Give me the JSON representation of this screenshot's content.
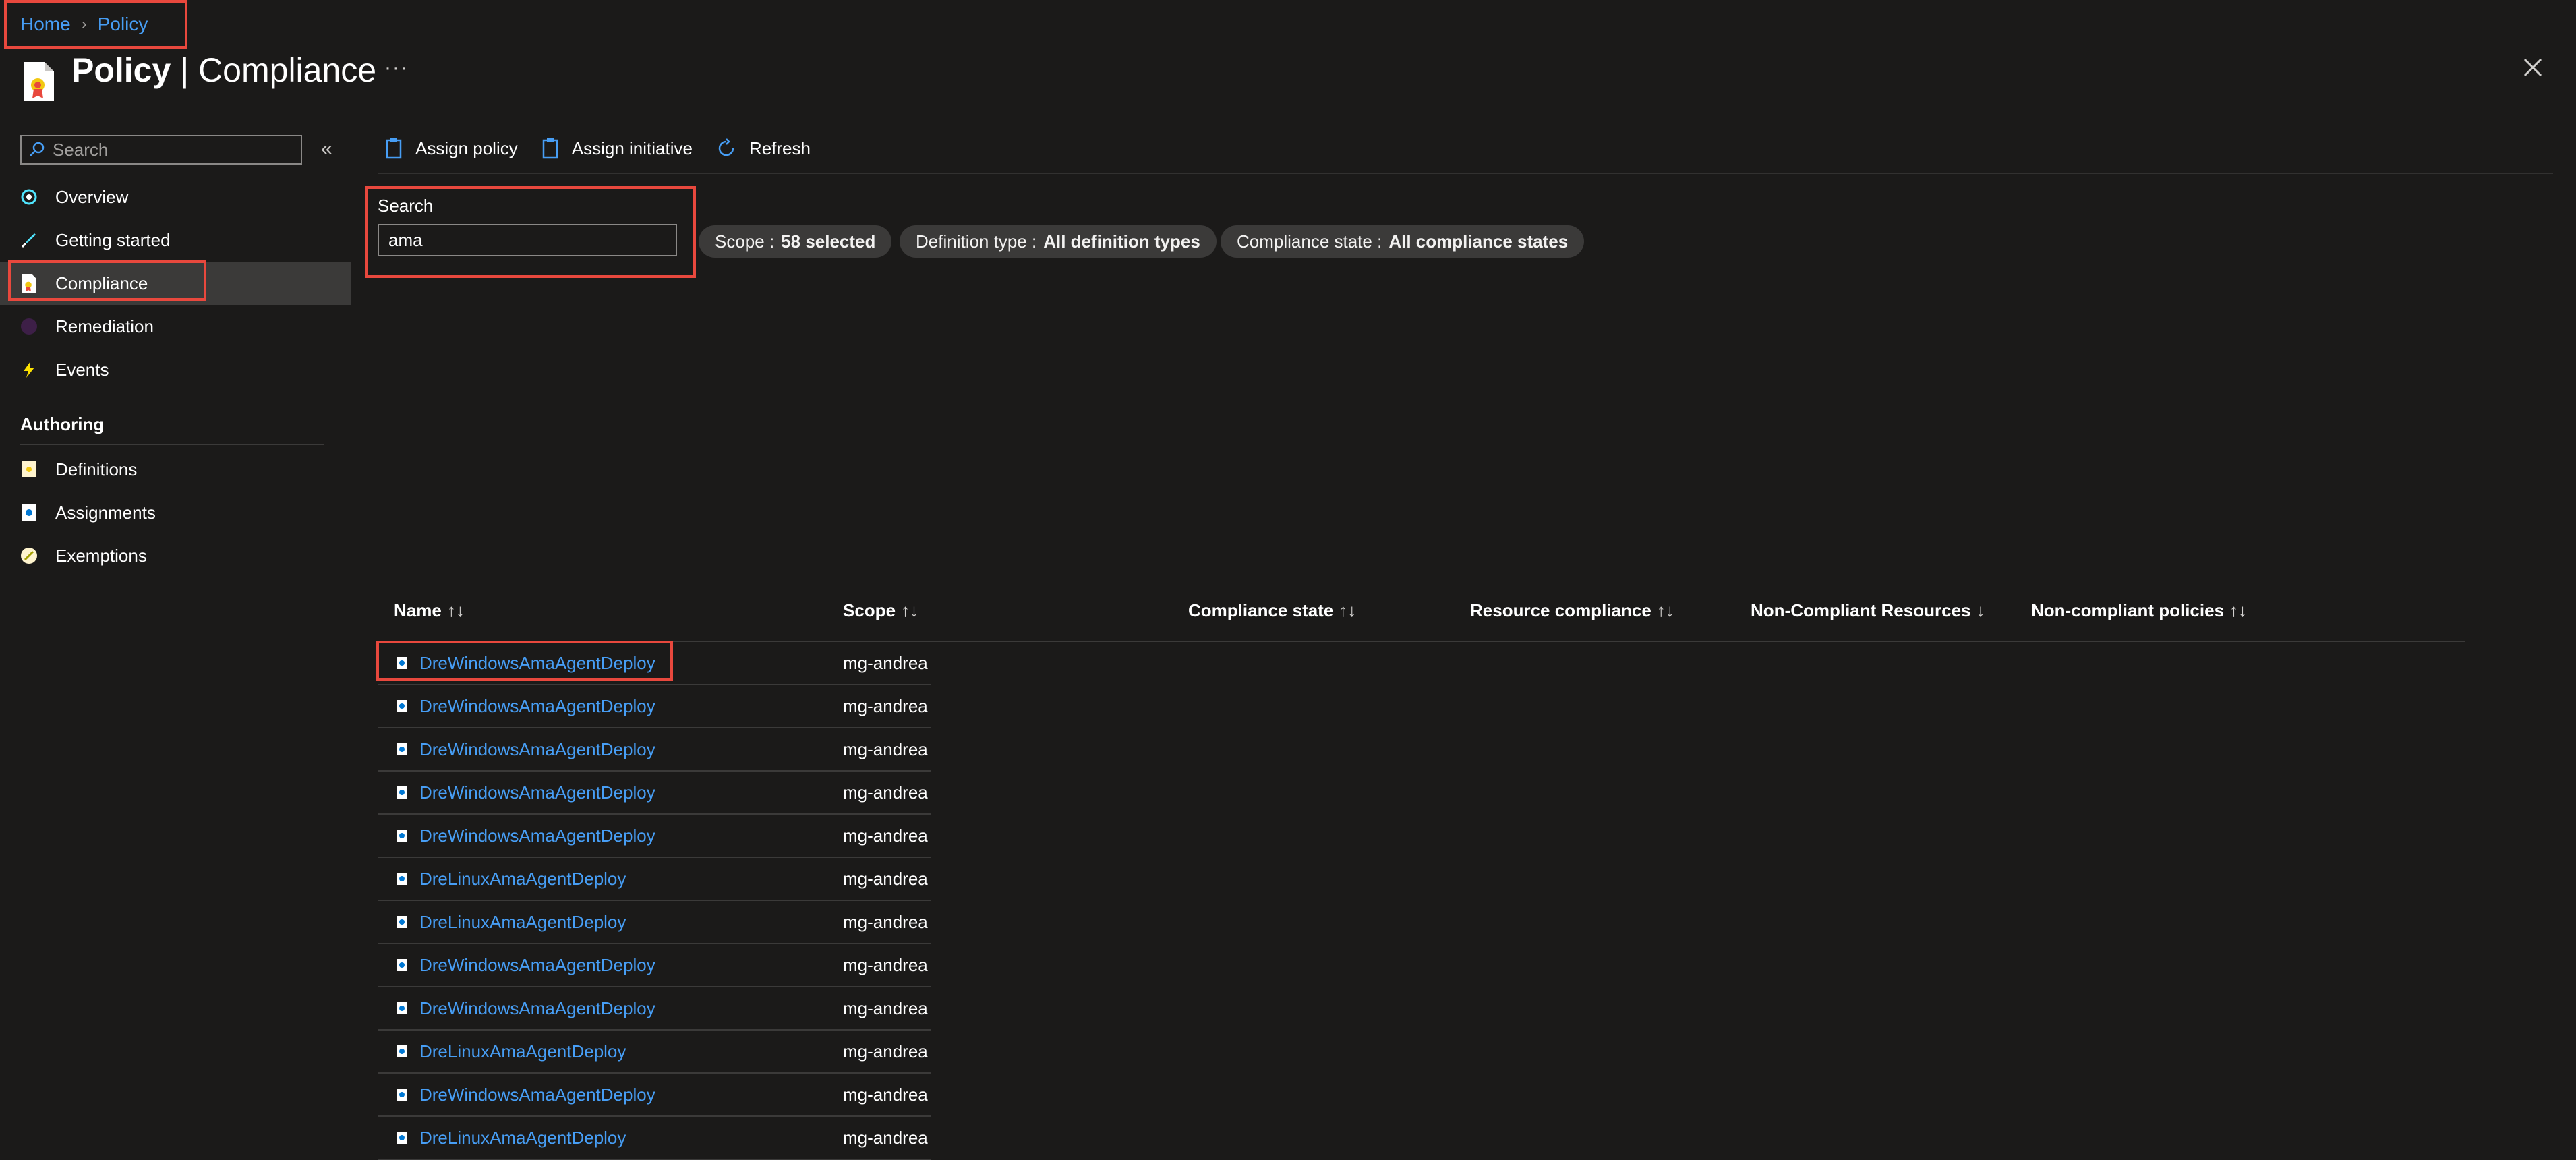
{
  "breadcrumb": {
    "home": "Home",
    "current": "Policy"
  },
  "header": {
    "title_bold": "Policy",
    "title_sep": " | ",
    "title_rest": "Compliance",
    "more": "···"
  },
  "sidebar": {
    "search_placeholder": "Search",
    "collapse": "«",
    "items": [
      {
        "label": "Overview",
        "icon": "overview-icon"
      },
      {
        "label": "Getting started",
        "icon": "rocket-icon"
      },
      {
        "label": "Compliance",
        "icon": "compliance-icon",
        "active": true
      },
      {
        "label": "Remediation",
        "icon": "remediation-icon"
      },
      {
        "label": "Events",
        "icon": "lightning-icon"
      }
    ],
    "section": "Authoring",
    "authoring_items": [
      {
        "label": "Definitions",
        "icon": "definitions-icon"
      },
      {
        "label": "Assignments",
        "icon": "assignments-icon"
      },
      {
        "label": "Exemptions",
        "icon": "exemptions-icon"
      }
    ]
  },
  "toolbar": {
    "assign_policy": "Assign policy",
    "assign_initiative": "Assign initiative",
    "refresh": "Refresh"
  },
  "filters": {
    "search_label": "Search",
    "search_value": "ama",
    "scope_label": "Scope : ",
    "scope_value": "58 selected",
    "deftype_label": "Definition type : ",
    "deftype_value": "All definition types",
    "state_label": "Compliance state : ",
    "state_value": "All compliance states"
  },
  "table": {
    "columns": [
      "Name",
      "Scope",
      "Compliance state",
      "Resource compliance",
      "Non-Compliant Resources",
      "Non-compliant policies"
    ],
    "sort_icons": [
      "↑↓",
      "↑↓",
      "↑↓",
      "↑↓",
      "↓",
      "↑↓"
    ],
    "rows": [
      {
        "name": "DreWindowsAmaAgentDeploy",
        "scope": "mg-andrea"
      },
      {
        "name": "DreWindowsAmaAgentDeploy",
        "scope": "mg-andrea"
      },
      {
        "name": "DreWindowsAmaAgentDeploy",
        "scope": "mg-andrea"
      },
      {
        "name": "DreWindowsAmaAgentDeploy",
        "scope": "mg-andrea"
      },
      {
        "name": "DreWindowsAmaAgentDeploy",
        "scope": "mg-andrea"
      },
      {
        "name": "DreLinuxAmaAgentDeploy",
        "scope": "mg-andrea"
      },
      {
        "name": "DreLinuxAmaAgentDeploy",
        "scope": "mg-andrea"
      },
      {
        "name": "DreWindowsAmaAgentDeploy",
        "scope": "mg-andrea"
      },
      {
        "name": "DreWindowsAmaAgentDeploy",
        "scope": "mg-andrea"
      },
      {
        "name": "DreLinuxAmaAgentDeploy",
        "scope": "mg-andrea"
      },
      {
        "name": "DreWindowsAmaAgentDeploy",
        "scope": "mg-andrea"
      },
      {
        "name": "DreLinuxAmaAgentDeploy",
        "scope": "mg-andrea"
      }
    ]
  },
  "colors": {
    "link": "#479ef5",
    "highlight": "#e8483d",
    "background": "#1b1a19"
  }
}
